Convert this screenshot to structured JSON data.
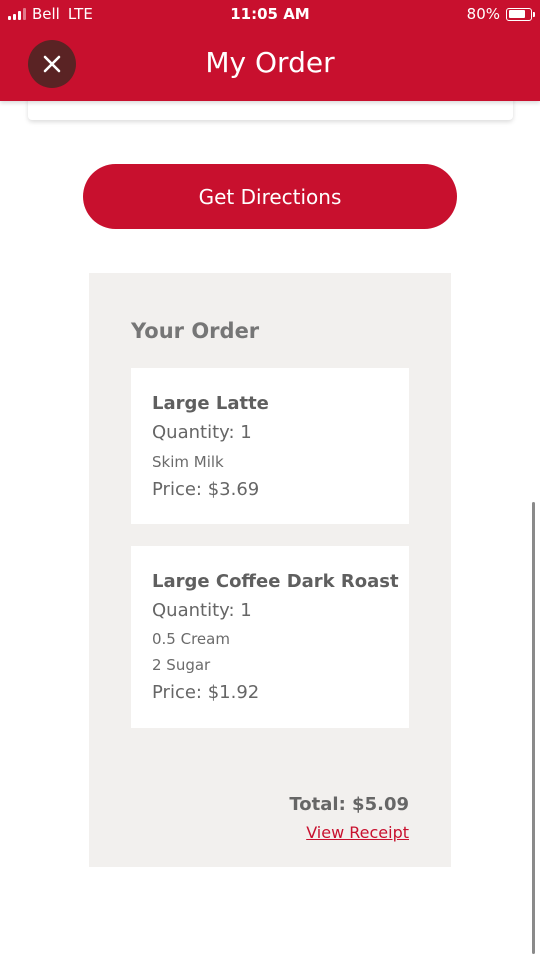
{
  "status_bar": {
    "carrier": "Bell",
    "network": "LTE",
    "time": "11:05 AM",
    "battery": "80%",
    "battery_level": 0.8
  },
  "header": {
    "title": "My Order",
    "close_icon": "close-icon"
  },
  "directions_button": {
    "label": "Get Directions"
  },
  "order": {
    "heading": "Your Order",
    "items": [
      {
        "name": "Large Latte",
        "quantity": "Quantity: 1",
        "modifiers": [
          "Skim Milk"
        ],
        "price": "Price: $3.69"
      },
      {
        "name": "Large Coffee Dark Roast",
        "quantity": "Quantity: 1",
        "modifiers": [
          "0.5 Cream",
          "2 Sugar"
        ],
        "price": "Price: $1.92"
      }
    ],
    "total": "Total: $5.09",
    "view_receipt": "View Receipt"
  },
  "colors": {
    "brand_red": "#c8102e",
    "close_button": "#5a2324",
    "panel_background": "#f2f0ee"
  }
}
